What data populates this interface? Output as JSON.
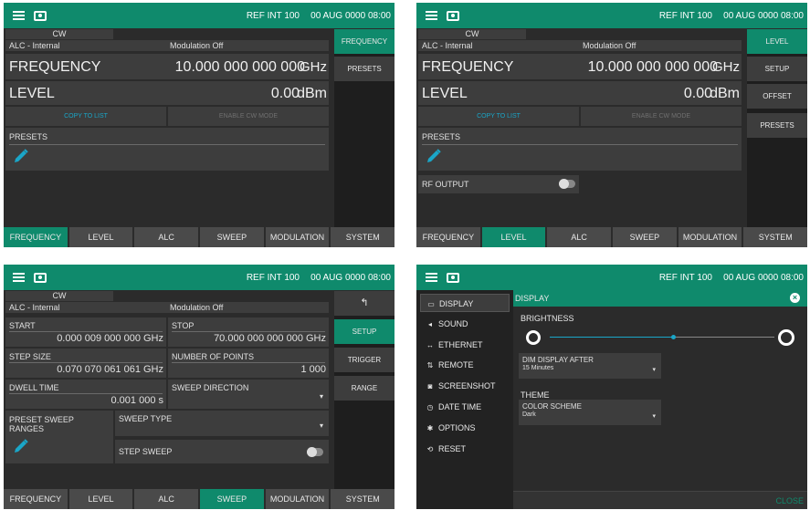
{
  "status": {
    "ref": "REF INT 100",
    "clock": "00 AUG 0000 08:00"
  },
  "p1": {
    "mode": "CW",
    "alc": "ALC - Internal",
    "modulation": "Modulation Off",
    "frequency_label": "FREQUENCY",
    "frequency_value": "10.000 000 000 000",
    "frequency_unit": "GHz",
    "level_label": "LEVEL",
    "level_value": "0.00",
    "level_unit": "dBm",
    "copy_to_list": "COPY TO LIST",
    "enable_cw": "ENABLE CW MODE",
    "presets_label": "PRESETS",
    "side": [
      "FREQUENCY",
      "PRESETS"
    ],
    "tabs": [
      "FREQUENCY",
      "LEVEL",
      "ALC",
      "SWEEP",
      "MODULATION",
      "SYSTEM"
    ]
  },
  "p2": {
    "mode": "CW",
    "alc": "ALC - Internal",
    "modulation": "Modulation Off",
    "frequency_label": "FREQUENCY",
    "frequency_value": "10.000 000 000 000",
    "frequency_unit": "GHz",
    "level_label": "LEVEL",
    "level_value": "0.00",
    "level_unit": "dBm",
    "copy_to_list": "COPY TO LIST",
    "enable_cw": "ENABLE CW MODE",
    "presets_label": "PRESETS",
    "rf_output": "RF OUTPUT",
    "side": [
      "LEVEL",
      "SETUP",
      "OFFSET",
      "PRESETS"
    ],
    "tabs": [
      "FREQUENCY",
      "LEVEL",
      "ALC",
      "SWEEP",
      "MODULATION",
      "SYSTEM"
    ]
  },
  "p3": {
    "mode": "CW",
    "alc": "ALC - Internal",
    "modulation": "Modulation Off",
    "start_label": "START",
    "start_value": "0.000 009 000 000 GHz",
    "stop_label": "STOP",
    "stop_value": "70.000 000 000 000 GHz",
    "step_label": "STEP SIZE",
    "step_value": "0.070 070 061 061 GHz",
    "points_label": "NUMBER OF POINTS",
    "points_value": "1 000",
    "dwell_label": "DWELL TIME",
    "dwell_value": "0.001 000 s",
    "direction_label": "SWEEP DIRECTION",
    "preset_ranges": "PRESET SWEEP RANGES",
    "sweep_type": "SWEEP TYPE",
    "step_sweep": "STEP SWEEP",
    "side": [
      "↰",
      "SETUP",
      "TRIGGER",
      "RANGE"
    ],
    "tabs": [
      "FREQUENCY",
      "LEVEL",
      "ALC",
      "SWEEP",
      "MODULATION",
      "SYSTEM"
    ]
  },
  "p4": {
    "menu": [
      {
        "icon": "▭",
        "label": "DISPLAY"
      },
      {
        "icon": "◂",
        "label": "SOUND"
      },
      {
        "icon": "↔",
        "label": "ETHERNET"
      },
      {
        "icon": "⇅",
        "label": "REMOTE"
      },
      {
        "icon": "◙",
        "label": "SCREENSHOT"
      },
      {
        "icon": "◷",
        "label": "DATE TIME"
      },
      {
        "icon": "✱",
        "label": "OPTIONS"
      },
      {
        "icon": "⟲",
        "label": "RESET"
      }
    ],
    "header": "DISPLAY",
    "brightness": "BRIGHTNESS",
    "brightness_level": 0.55,
    "dim_label": "DIM DISPLAY AFTER",
    "dim_value": "15 Minutes",
    "theme": "THEME",
    "scheme_label": "COLOR SCHEME",
    "scheme_value": "Dark",
    "close": "CLOSE"
  },
  "colors": {
    "accent": "#0f8a6c",
    "link": "#1aa6c8"
  }
}
